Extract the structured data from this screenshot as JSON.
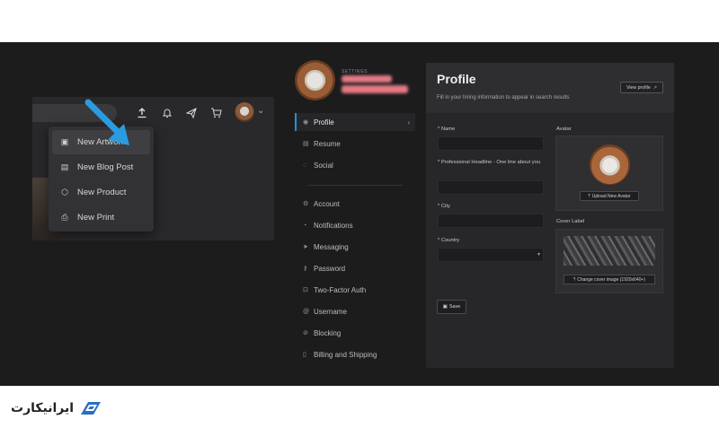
{
  "toolbar": {
    "icons": [
      "upload-icon",
      "bell-icon",
      "send-icon",
      "cart-icon"
    ],
    "chevron": "⌄"
  },
  "dropdown": {
    "items": [
      {
        "label": "New Artwork",
        "icon": "image-icon"
      },
      {
        "label": "New Blog Post",
        "icon": "document-icon"
      },
      {
        "label": "New Product",
        "icon": "box-icon"
      },
      {
        "label": "New Print",
        "icon": "print-icon"
      }
    ]
  },
  "settings": {
    "small_label": "SETTINGS"
  },
  "sidebar": {
    "items": [
      {
        "label": "Profile",
        "icon": "user-icon",
        "active": true
      },
      {
        "label": "Resume",
        "icon": "file-icon"
      },
      {
        "label": "Social",
        "icon": "chat-icon"
      },
      {
        "label": "Account",
        "icon": "gear-icon"
      },
      {
        "label": "Notifications",
        "icon": "bell-icon"
      },
      {
        "label": "Messaging",
        "icon": "send-icon"
      },
      {
        "label": "Password",
        "icon": "key-icon"
      },
      {
        "label": "Two-Factor Auth",
        "icon": "lock-icon"
      },
      {
        "label": "Username",
        "icon": "at-icon"
      },
      {
        "label": "Blocking",
        "icon": "block-icon"
      },
      {
        "label": "Billing and Shipping",
        "icon": "receipt-icon"
      }
    ]
  },
  "profile": {
    "title": "Profile",
    "subtitle": "Fill in your hiring information to appear in search results",
    "view_button": "View profile",
    "fields": {
      "name_label": "* Name",
      "headline_label": "* Professional Headline - One line about you",
      "city_label": "* City",
      "country_label": "* Country"
    },
    "avatar_label": "Avatar",
    "upload_avatar": "Upload New Avatar",
    "cover_label": "Cover Label",
    "change_cover": "Change cover image (1920x640+)",
    "save": "Save"
  },
  "logo": {
    "text": "ایرانیکارت"
  },
  "colors": {
    "accent": "#2a8fd8",
    "arrow": "#2b9be0",
    "background": "#1c1c1d",
    "panel": "#272729"
  }
}
